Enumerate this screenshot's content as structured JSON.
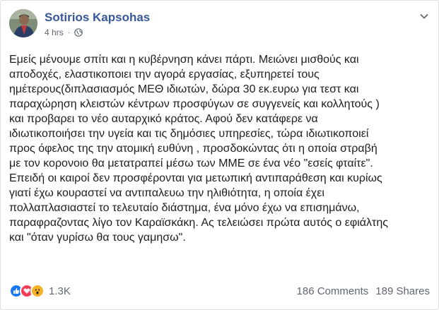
{
  "post": {
    "author": "Sotirios Kapsohas",
    "time": "4 hrs",
    "separator": "·",
    "privacy_icon": "globe-icon",
    "menu_icon": "chevron-down-icon",
    "lines": [
      "Εμείς μένουμε σπίτι και η κυβέρνηση κάνει πάρτι. Μειώνει μισθούς και",
      "αποδοχές, ελαστικοποιει την αγορά εργασίας, εξυπηρετεί τους",
      "ημέτερους(διπλασιασμός ΜΕΘ ιδιωτών, δώρα 30 εκ.ευρω για τεστ και",
      "παραχώρηση κλειστών κέντρων προσφύγων σε συγγενείς και κολλητούς )",
      "και προβαρει το νέο αυταρχικό κράτος. Αφού δεν κατάφερε να",
      "ιδιωτικοποιήσει την υγεία και τις δημόσιες υπηρεσίες, τώρα ιδιωτικοποιεί",
      "προς όφελος της την ατομική ευθύνη , προσδοκώντας ότι η οποία στραβή",
      "με τον κορονοιο θα μετατραπεί μέσω των ΜΜΕ σε ένα νέο \"εσείς φταίτε\".",
      "Επειδή οι καιροί δεν προσφέρονται για μετωπική αντιπαράθεση και κυρίως",
      "γιατί έχω κουραστεί να αντιπαλευω την ηλιθιότητα, η οποία έχει",
      "πολλαπλασιαστεί το τελευταίο διάστημα, ένα μόνο έχω να επισημάνω,",
      "παραφραζοντας λίγο τον Καραϊσκάκη. Ας τελειώσει πρώτα αυτός ο εφιάλτης",
      "και \"όταν γυρίσω θα τους γαμησω\"."
    ]
  },
  "footer": {
    "reaction_icons": [
      "like-icon",
      "love-icon",
      "wow-icon"
    ],
    "reaction_count": "1.3K",
    "comments": "186 Comments",
    "shares": "189 Shares"
  },
  "colors": {
    "author": "#385898",
    "like": "#1877f2",
    "love": "#f33e58",
    "wow": "#f7b125",
    "meta": "#616770"
  }
}
